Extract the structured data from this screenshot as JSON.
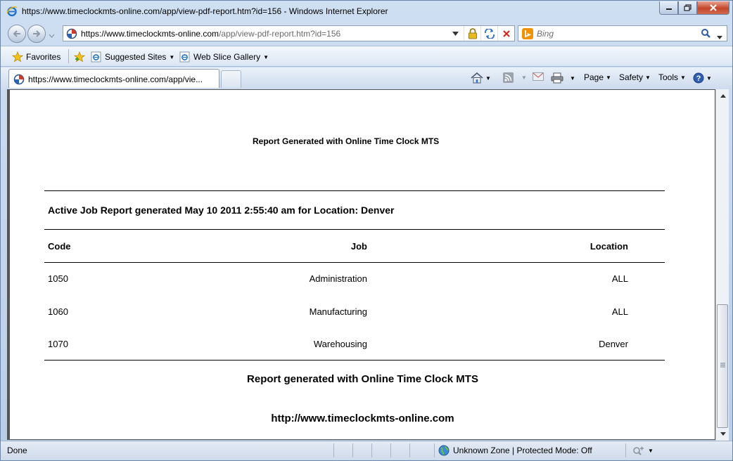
{
  "window": {
    "title": "https://www.timeclockmts-online.com/app/view-pdf-report.htm?id=156 - Windows Internet Explorer"
  },
  "address_bar": {
    "url_domain": "https://www.timeclockmts-online.com",
    "url_path": "/app/view-pdf-report.htm?id=156"
  },
  "search": {
    "placeholder": "Bing"
  },
  "favorites_bar": {
    "favorites_label": "Favorites",
    "suggested_sites_label": "Suggested Sites",
    "web_slice_gallery_label": "Web Slice Gallery"
  },
  "tabs": [
    {
      "label": "https://www.timeclockmts-online.com/app/vie..."
    }
  ],
  "command_bar": {
    "page_label": "Page",
    "safety_label": "Safety",
    "tools_label": "Tools"
  },
  "report": {
    "header": "Report Generated with Online Time Clock MTS",
    "title": "Active Job Report generated May 10 2011 2:55:40 am for Location: Denver",
    "columns": [
      "Code",
      "Job",
      "Location"
    ],
    "rows": [
      {
        "code": "1050",
        "job": "Administration",
        "location": "ALL"
      },
      {
        "code": "1060",
        "job": "Manufacturing",
        "location": "ALL"
      },
      {
        "code": "1070",
        "job": "Warehousing",
        "location": "Denver"
      }
    ],
    "footer_text": "Report generated with Online Time Clock MTS",
    "footer_url": "http://www.timeclockmts-online.com"
  },
  "status_bar": {
    "status": "Done",
    "zone": "Unknown Zone | Protected Mode: Off"
  },
  "icons": {
    "ie": "ie-logo-icon",
    "back": "back-arrow-icon",
    "forward": "forward-arrow-icon",
    "lock": "lock-icon",
    "refresh": "refresh-icon",
    "stop": "stop-icon",
    "bing": "bing-icon",
    "search": "magnifier-icon",
    "star": "star-icon",
    "home": "home-icon",
    "rss": "rss-icon",
    "mail": "mail-icon",
    "print": "print-icon",
    "help": "help-icon",
    "globe": "globe-icon"
  },
  "colors": {
    "close_button": "#c4452b",
    "chrome_blue": "#cfdff2"
  }
}
